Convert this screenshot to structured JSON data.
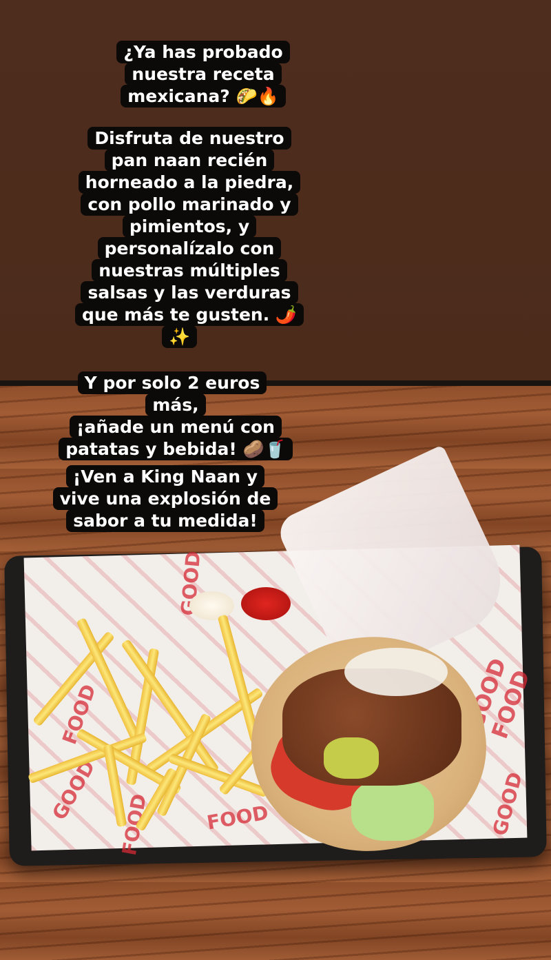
{
  "story": {
    "block1": [
      "¿Ya has probado",
      "nuestra receta",
      "mexicana? 🌮🔥"
    ],
    "block2": [
      "Disfruta de nuestro",
      "pan naan recién",
      "horneado a la piedra,",
      "con pollo marinado y",
      "pimientos, y",
      "personalízalo con",
      "nuestras múltiples",
      "salsas y las verduras",
      "que más te gusten. 🌶️",
      "✨"
    ],
    "block3": [
      "Y por solo 2 euros más,",
      "¡añade un menú con",
      "patatas y bebida! 🥔🥤"
    ],
    "block4": [
      "¡Ven a King Naan y",
      "vive una explosión de",
      "sabor a tu medida!"
    ]
  },
  "photo": {
    "paper_print": [
      "GOOD",
      "GOOD",
      "FOOD",
      "GOOD FOOD",
      "FOOD",
      "GOOD",
      "FOOD"
    ]
  },
  "colors": {
    "background": "#4c2b1b",
    "text_bg": "#0c0a09",
    "brand_red": "#d62a35"
  }
}
